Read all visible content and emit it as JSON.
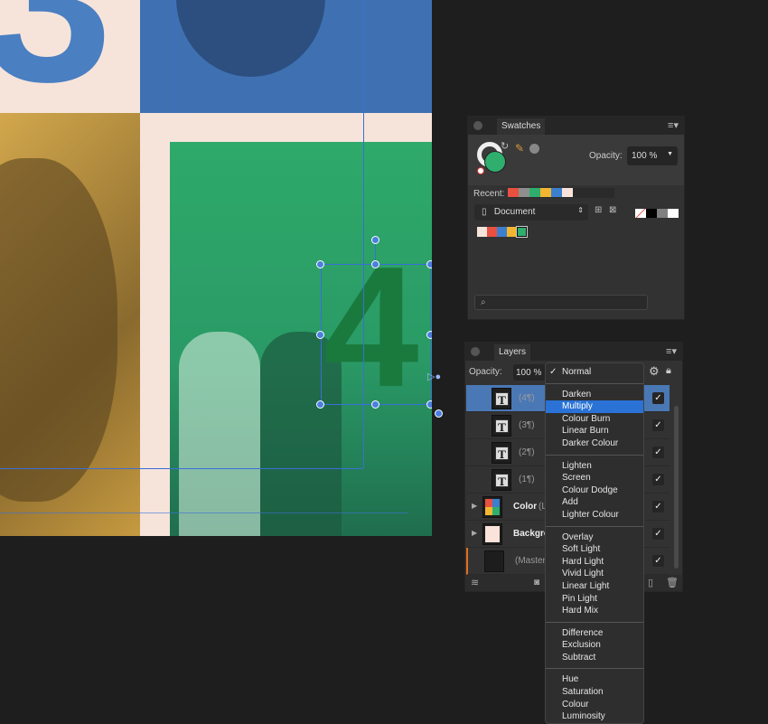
{
  "canvas": {
    "digit_top": "3",
    "digit_main": "4"
  },
  "swatches": {
    "title": "Swatches",
    "opacity_label": "Opacity:",
    "opacity_value": "100 %",
    "recent_label": "Recent:",
    "recent_colors": [
      "#e9503f",
      "#8e8e8e",
      "#2fae6e",
      "#f2b630",
      "#3b7fcf",
      "#f9e3da"
    ],
    "palette_select": "Document",
    "document_colors": [
      "#f6e4db",
      "#e9503f",
      "#3b7fcf",
      "#f2b630",
      "#2fae6e"
    ],
    "basic_colors": [
      "#000000",
      "#808080",
      "#ffffff"
    ],
    "search_placeholder": ""
  },
  "layers": {
    "title": "Layers",
    "opacity_label": "Opacity:",
    "opacity_value": "100 %",
    "rows": [
      {
        "name": "(4¶)",
        "type": "text",
        "selected": true,
        "visible": true
      },
      {
        "name": "(3¶)",
        "type": "text",
        "visible": true
      },
      {
        "name": "(2¶)",
        "type": "text",
        "visible": true
      },
      {
        "name": "(1¶)",
        "type": "text",
        "visible": true
      },
      {
        "name": "Color",
        "suffix": "(La",
        "type": "group",
        "visible": true
      },
      {
        "name": "Backgro",
        "type": "group",
        "visible": true
      },
      {
        "name": "(Master ",
        "type": "master",
        "visible": true
      }
    ]
  },
  "blend_menu": {
    "checked": "Normal",
    "highlighted": "Multiply",
    "groups": [
      [
        "Normal"
      ],
      [
        "Darken",
        "Multiply",
        "Colour Burn",
        "Linear Burn",
        "Darker Colour"
      ],
      [
        "Lighten",
        "Screen",
        "Colour Dodge",
        "Add",
        "Lighter Colour"
      ],
      [
        "Overlay",
        "Soft Light",
        "Hard Light",
        "Vivid Light",
        "Linear Light",
        "Pin Light",
        "Hard Mix"
      ],
      [
        "Difference",
        "Exclusion",
        "Subtract"
      ],
      [
        "Hue",
        "Saturation",
        "Colour",
        "Luminosity"
      ]
    ]
  }
}
